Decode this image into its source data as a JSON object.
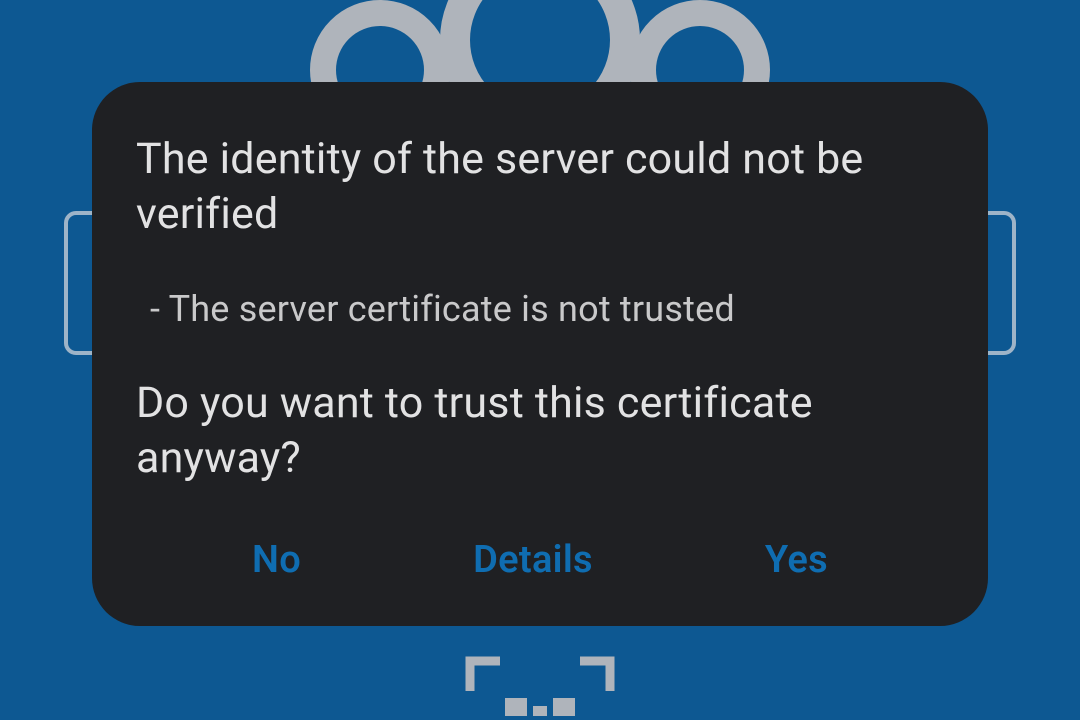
{
  "dialog": {
    "title": "The identity of the server could not be verified",
    "reason": "- The server certificate is not trusted",
    "question": "Do you want to trust this certificate anyway?",
    "actions": {
      "no": "No",
      "details": "Details",
      "yes": "Yes"
    }
  }
}
